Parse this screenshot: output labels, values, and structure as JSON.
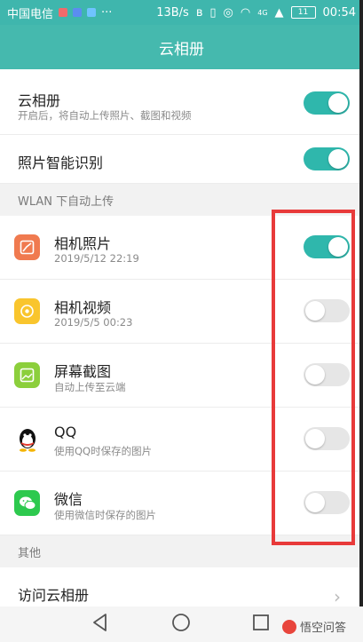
{
  "status": {
    "carrier": "中国电信",
    "speed": "13B/s",
    "network": "4G",
    "battery": "11",
    "time": "00:54"
  },
  "header": {
    "title": "云相册"
  },
  "settings": [
    {
      "title": "云相册",
      "subtitle": "开启后，将自动上传照片、截图和视频",
      "enabled": true
    },
    {
      "title": "照片智能识别",
      "enabled": true
    }
  ],
  "sections": {
    "wlan_upload": "WLAN 下自动上传",
    "other": "其他"
  },
  "upload_sources": [
    {
      "title": "相机照片",
      "subtitle": "2019/5/12 22:19",
      "enabled": true,
      "icon": "camera-photo-icon",
      "color": "#f07a4f"
    },
    {
      "title": "相机视频",
      "subtitle": "2019/5/5 00:23",
      "enabled": false,
      "icon": "camera-video-icon",
      "color": "#f9c52d"
    },
    {
      "title": "屏幕截图",
      "subtitle": "自动上传至云端",
      "enabled": false,
      "icon": "screenshot-icon",
      "color": "#8ccf3c"
    },
    {
      "title": "QQ",
      "subtitle": "使用QQ时保存的图片",
      "enabled": false,
      "icon": "qq-penguin-icon",
      "color": "#111111"
    },
    {
      "title": "微信",
      "subtitle": "使用微信时保存的图片",
      "enabled": false,
      "icon": "wechat-icon",
      "color": "#2dc94e"
    }
  ],
  "other": {
    "visit_label": "访问云相册"
  },
  "watermark": {
    "text": "悟空问答"
  },
  "colors": {
    "accent": "#45b9ae",
    "toggle_on": "#2fb7ac",
    "highlight_box": "#e83a3a"
  }
}
